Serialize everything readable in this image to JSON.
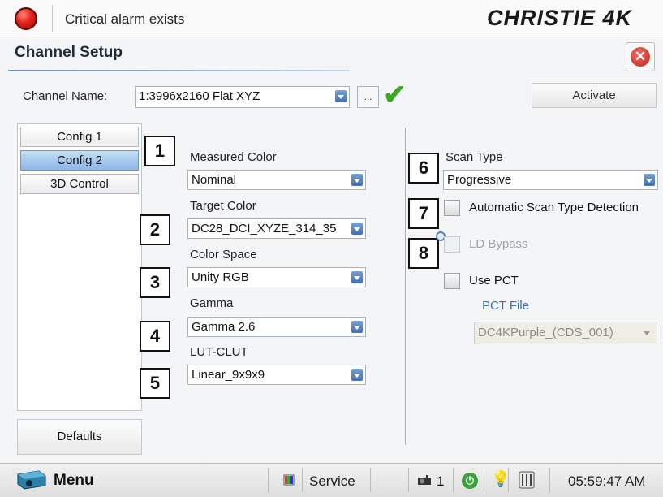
{
  "alarm": {
    "text": "Critical alarm exists",
    "dot_color": "#e52218"
  },
  "brand": "CHRISTIE 4K",
  "window": {
    "title": "Channel Setup",
    "close_icon": "close-icon",
    "channel_name_label": "Channel Name:",
    "channel_name_value": "1:3996x2160 Flat XYZ",
    "more_button": "...",
    "activate_button": "Activate"
  },
  "tabs": [
    {
      "label": "Config 1",
      "selected": false
    },
    {
      "label": "Config 2",
      "selected": true
    },
    {
      "label": "3D Control",
      "selected": false
    }
  ],
  "defaults_button": "Defaults",
  "callouts": [
    "1",
    "2",
    "3",
    "4",
    "5",
    "6",
    "7",
    "8"
  ],
  "left_fields": [
    {
      "label": "Measured Color",
      "value": "Nominal"
    },
    {
      "label": "Target Color",
      "value": "DC28_DCI_XYZE_314_35"
    },
    {
      "label": "Color Space",
      "value": "Unity RGB"
    },
    {
      "label": "Gamma",
      "value": "Gamma 2.6"
    },
    {
      "label": "LUT-CLUT",
      "value": "Linear_9x9x9"
    }
  ],
  "right": {
    "scan_type_label": "Scan Type",
    "scan_type_value": "Progressive",
    "auto_scan_label": "Automatic Scan Type Detection",
    "ld_bypass_label": "LD Bypass",
    "use_pct_label": "Use PCT",
    "pct_file_label": "PCT File",
    "pct_file_value": "DC4KPurple_(CDS_001)"
  },
  "statusbar": {
    "menu_label": "Menu",
    "service_label": "Service",
    "projector_count": "1",
    "power_icon": "power-icon",
    "bulb_icon": "bulb-icon",
    "lamp_icon": "lamp-icon",
    "time": "05:59:47 AM"
  },
  "colors": {
    "accent": "#3f6fb5",
    "check": "#3ea825",
    "link": "#3a6fb5"
  }
}
